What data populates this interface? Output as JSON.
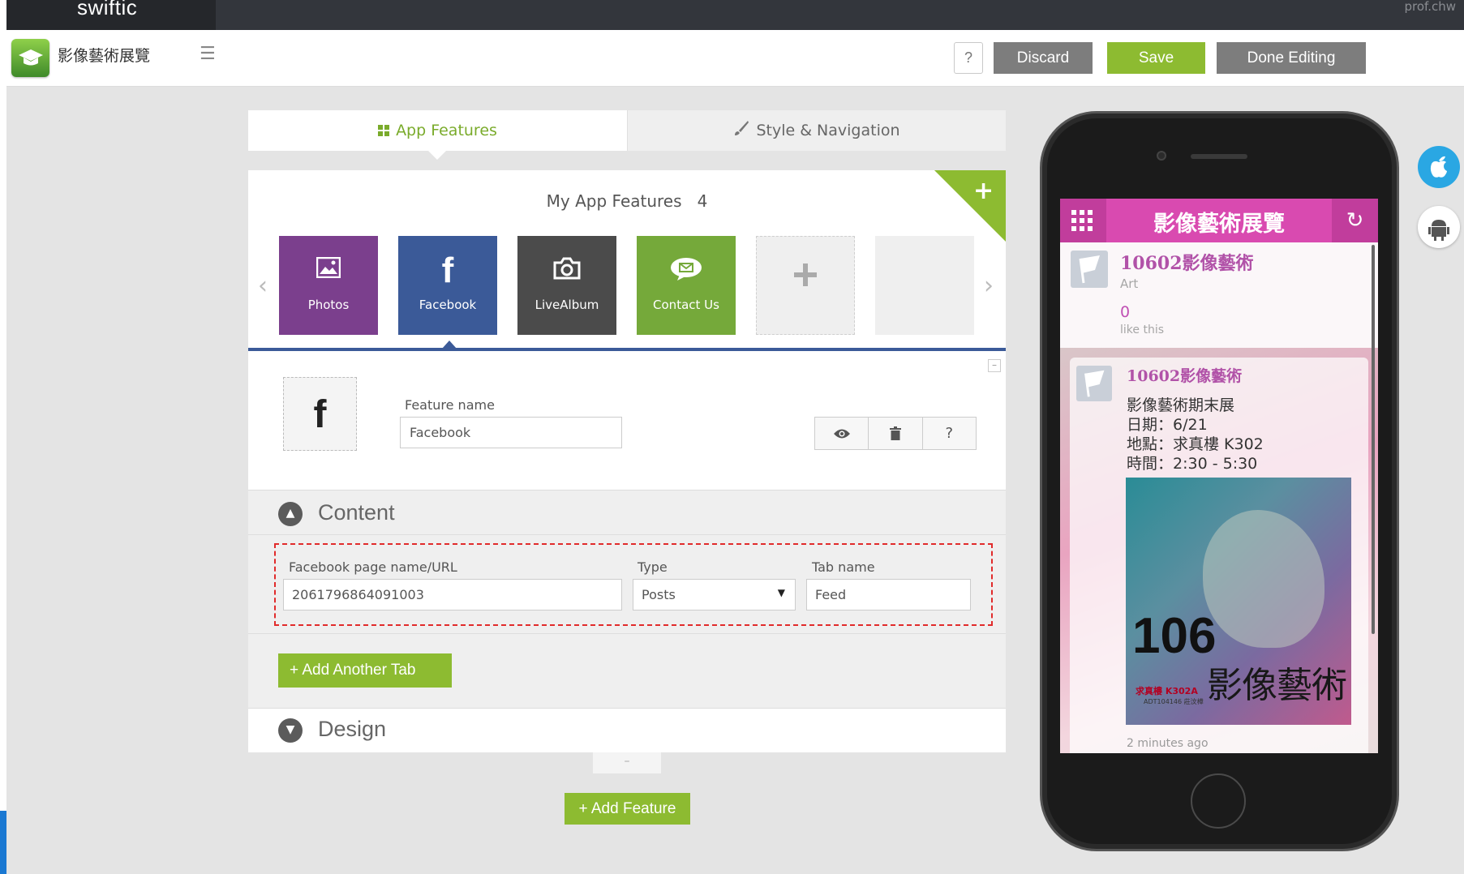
{
  "topbar": {
    "brand": "swiftic",
    "user": "prof.chw"
  },
  "header": {
    "app_name": "影像藝術展覽",
    "help_label": "?",
    "discard_label": "Discard",
    "save_label": "Save",
    "done_label": "Done Editing"
  },
  "tabs": [
    {
      "label": "App Features",
      "icon": "grid-icon",
      "active": true
    },
    {
      "label": "Style & Navigation",
      "icon": "brush-icon",
      "active": false
    }
  ],
  "features": {
    "title": "My App Features",
    "count": "4",
    "tiles": [
      {
        "label": "Photos",
        "icon": "image-icon",
        "color": "#7b3f8d"
      },
      {
        "label": "Facebook",
        "icon": "facebook-icon",
        "color": "#3b5a98"
      },
      {
        "label": "LiveAlbum",
        "icon": "camera-icon",
        "color": "#4b4b4b"
      },
      {
        "label": "Contact Us",
        "icon": "chat-icon",
        "color": "#75a93a"
      }
    ],
    "add_tile_icon": "plus-icon"
  },
  "feature_detail": {
    "name_label": "Feature name",
    "name_value": "Facebook",
    "actions": [
      "eye-icon",
      "trash-icon",
      "help-icon"
    ],
    "help_text": "?"
  },
  "content_section": {
    "title": "Content",
    "fb_label": "Facebook page name/URL",
    "fb_value": "2061796864091003",
    "type_label": "Type",
    "type_value": "Posts",
    "tab_label": "Tab name",
    "tab_value": "Feed",
    "add_tab_label": "+  Add Another Tab"
  },
  "design_section": {
    "title": "Design"
  },
  "minimize_label": "–",
  "add_feature_label": "+ Add Feature",
  "phone": {
    "app_title": "影像藝術展覽",
    "page_name": "10602影像藝術",
    "page_category": "Art",
    "likes_count": "0",
    "likes_label": "like this",
    "post_page": "10602影像藝術",
    "post_lines": [
      "影像藝術期末展",
      "日期：6/21",
      "地點：求真樓 K302",
      "時間：2:30 - 5:30"
    ],
    "poster_number": "106",
    "poster_title": "影像藝術",
    "poster_small": "求真樓 K302A",
    "poster_small2": "ADT104146 莊汶樺",
    "post_time": "2 minutes ago"
  },
  "colors": {
    "accent_green": "#8dbb31",
    "facebook_blue": "#3b5a98",
    "app_pink": "#d94ab0"
  }
}
